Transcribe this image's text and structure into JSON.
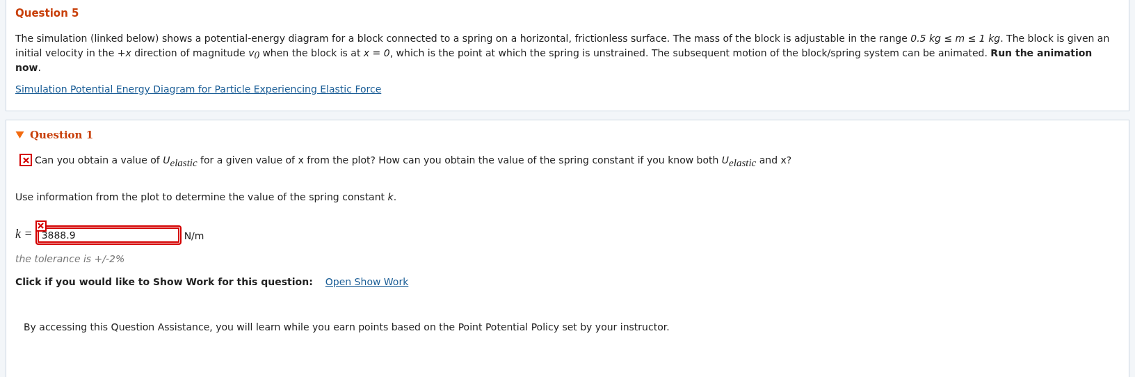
{
  "problem": {
    "title": "Question 5",
    "text": "The simulation (linked below) shows a potential-energy diagram for a block connected to a spring on a horizontal, frictionless surface. The mass of the block is adjustable in the range *0.5 kg ≤ m ≤ 1 kg*. The block is given an initial velocity in the *+x* direction of magnitude *v*$_{0}$ when the block is at *x = 0*, which is the point at which the spring is unstrained. The subsequent motion of the block/spring system can be animated. **Run the animation now**.",
    "link": "Simulation Potential Energy Diagram for Particle Experiencing Elastic Force"
  },
  "question": {
    "title": "Question 1",
    "expanded": true,
    "hint": {
      "correct": false,
      "text": "Can you obtain a value of *U*$_{elastic}$ for a given value of x from the plot? How can you obtain the value of the spring constant if you know both *U*$_{elastic}$ and x?"
    },
    "prompt": "Use information from the plot to determine the value of the spring constant *k*.",
    "answer": {
      "label": "k =",
      "value": "3888.9",
      "unit": "N/m",
      "correct": false
    },
    "tolerance": "the tolerance is +/-2%",
    "show_work": {
      "label": "Click if you would like to Show Work for this question:",
      "link": "Open Show Work"
    },
    "assistance": "By accessing this Question Assistance, you will learn while you earn points based on the Point Potential Policy set by your instructor."
  }
}
